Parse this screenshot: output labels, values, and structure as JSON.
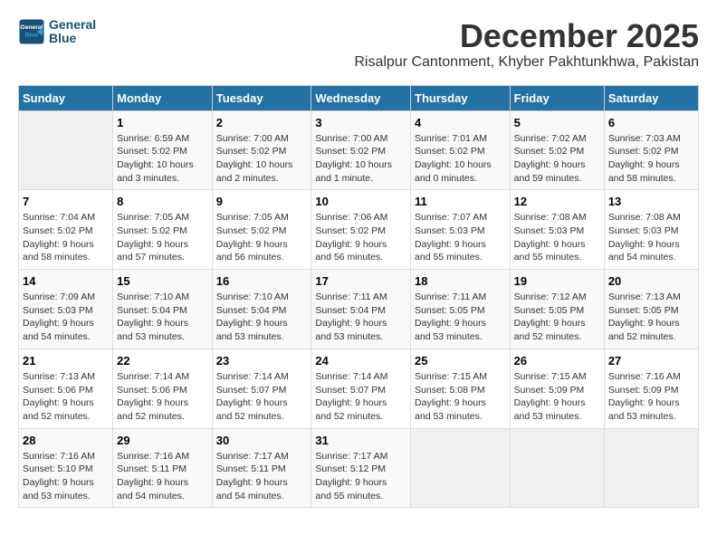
{
  "logo": {
    "line1": "General",
    "line2": "Blue"
  },
  "title": "December 2025",
  "subtitle": "Risalpur Cantonment, Khyber Pakhtunkhwa, Pakistan",
  "header_days": [
    "Sunday",
    "Monday",
    "Tuesday",
    "Wednesday",
    "Thursday",
    "Friday",
    "Saturday"
  ],
  "weeks": [
    [
      {
        "day": "",
        "info": ""
      },
      {
        "day": "1",
        "info": "Sunrise: 6:59 AM\nSunset: 5:02 PM\nDaylight: 10 hours\nand 3 minutes."
      },
      {
        "day": "2",
        "info": "Sunrise: 7:00 AM\nSunset: 5:02 PM\nDaylight: 10 hours\nand 2 minutes."
      },
      {
        "day": "3",
        "info": "Sunrise: 7:00 AM\nSunset: 5:02 PM\nDaylight: 10 hours\nand 1 minute."
      },
      {
        "day": "4",
        "info": "Sunrise: 7:01 AM\nSunset: 5:02 PM\nDaylight: 10 hours\nand 0 minutes."
      },
      {
        "day": "5",
        "info": "Sunrise: 7:02 AM\nSunset: 5:02 PM\nDaylight: 9 hours\nand 59 minutes."
      },
      {
        "day": "6",
        "info": "Sunrise: 7:03 AM\nSunset: 5:02 PM\nDaylight: 9 hours\nand 58 minutes."
      }
    ],
    [
      {
        "day": "7",
        "info": "Sunrise: 7:04 AM\nSunset: 5:02 PM\nDaylight: 9 hours\nand 58 minutes."
      },
      {
        "day": "8",
        "info": "Sunrise: 7:05 AM\nSunset: 5:02 PM\nDaylight: 9 hours\nand 57 minutes."
      },
      {
        "day": "9",
        "info": "Sunrise: 7:05 AM\nSunset: 5:02 PM\nDaylight: 9 hours\nand 56 minutes."
      },
      {
        "day": "10",
        "info": "Sunrise: 7:06 AM\nSunset: 5:02 PM\nDaylight: 9 hours\nand 56 minutes."
      },
      {
        "day": "11",
        "info": "Sunrise: 7:07 AM\nSunset: 5:03 PM\nDaylight: 9 hours\nand 55 minutes."
      },
      {
        "day": "12",
        "info": "Sunrise: 7:08 AM\nSunset: 5:03 PM\nDaylight: 9 hours\nand 55 minutes."
      },
      {
        "day": "13",
        "info": "Sunrise: 7:08 AM\nSunset: 5:03 PM\nDaylight: 9 hours\nand 54 minutes."
      }
    ],
    [
      {
        "day": "14",
        "info": "Sunrise: 7:09 AM\nSunset: 5:03 PM\nDaylight: 9 hours\nand 54 minutes."
      },
      {
        "day": "15",
        "info": "Sunrise: 7:10 AM\nSunset: 5:04 PM\nDaylight: 9 hours\nand 53 minutes."
      },
      {
        "day": "16",
        "info": "Sunrise: 7:10 AM\nSunset: 5:04 PM\nDaylight: 9 hours\nand 53 minutes."
      },
      {
        "day": "17",
        "info": "Sunrise: 7:11 AM\nSunset: 5:04 PM\nDaylight: 9 hours\nand 53 minutes."
      },
      {
        "day": "18",
        "info": "Sunrise: 7:11 AM\nSunset: 5:05 PM\nDaylight: 9 hours\nand 53 minutes."
      },
      {
        "day": "19",
        "info": "Sunrise: 7:12 AM\nSunset: 5:05 PM\nDaylight: 9 hours\nand 52 minutes."
      },
      {
        "day": "20",
        "info": "Sunrise: 7:13 AM\nSunset: 5:05 PM\nDaylight: 9 hours\nand 52 minutes."
      }
    ],
    [
      {
        "day": "21",
        "info": "Sunrise: 7:13 AM\nSunset: 5:06 PM\nDaylight: 9 hours\nand 52 minutes."
      },
      {
        "day": "22",
        "info": "Sunrise: 7:14 AM\nSunset: 5:06 PM\nDaylight: 9 hours\nand 52 minutes."
      },
      {
        "day": "23",
        "info": "Sunrise: 7:14 AM\nSunset: 5:07 PM\nDaylight: 9 hours\nand 52 minutes."
      },
      {
        "day": "24",
        "info": "Sunrise: 7:14 AM\nSunset: 5:07 PM\nDaylight: 9 hours\nand 52 minutes."
      },
      {
        "day": "25",
        "info": "Sunrise: 7:15 AM\nSunset: 5:08 PM\nDaylight: 9 hours\nand 53 minutes."
      },
      {
        "day": "26",
        "info": "Sunrise: 7:15 AM\nSunset: 5:09 PM\nDaylight: 9 hours\nand 53 minutes."
      },
      {
        "day": "27",
        "info": "Sunrise: 7:16 AM\nSunset: 5:09 PM\nDaylight: 9 hours\nand 53 minutes."
      }
    ],
    [
      {
        "day": "28",
        "info": "Sunrise: 7:16 AM\nSunset: 5:10 PM\nDaylight: 9 hours\nand 53 minutes."
      },
      {
        "day": "29",
        "info": "Sunrise: 7:16 AM\nSunset: 5:11 PM\nDaylight: 9 hours\nand 54 minutes."
      },
      {
        "day": "30",
        "info": "Sunrise: 7:17 AM\nSunset: 5:11 PM\nDaylight: 9 hours\nand 54 minutes."
      },
      {
        "day": "31",
        "info": "Sunrise: 7:17 AM\nSunset: 5:12 PM\nDaylight: 9 hours\nand 55 minutes."
      },
      {
        "day": "",
        "info": ""
      },
      {
        "day": "",
        "info": ""
      },
      {
        "day": "",
        "info": ""
      }
    ]
  ]
}
